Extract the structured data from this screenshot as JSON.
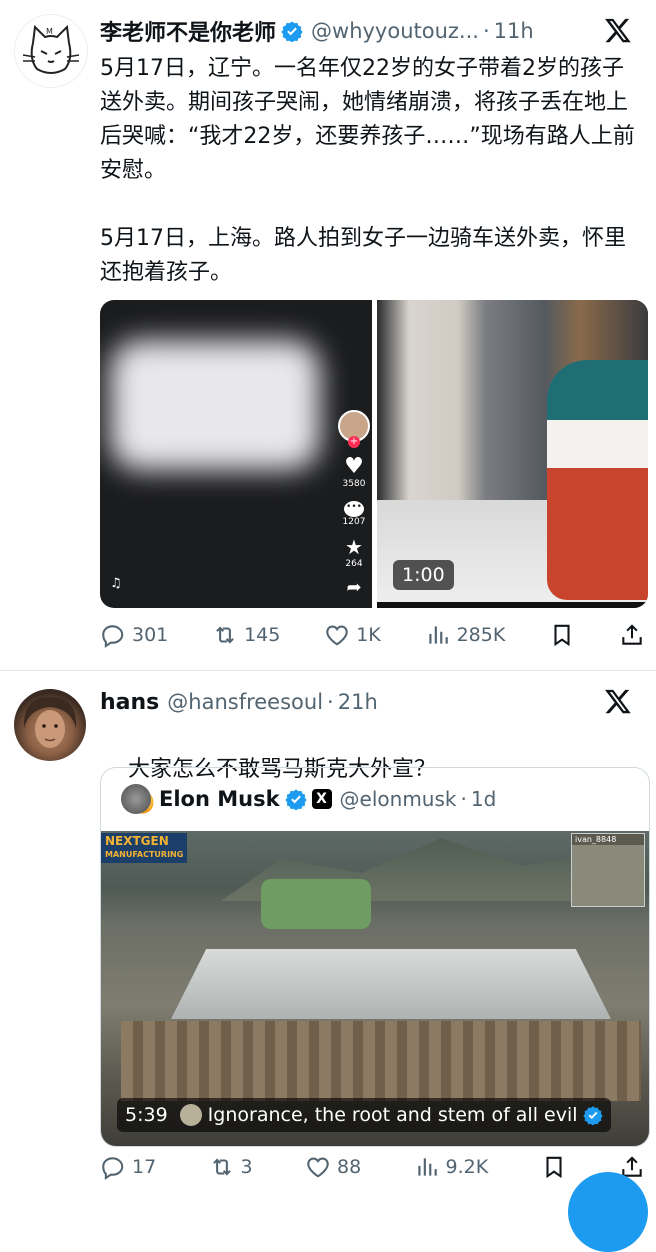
{
  "tweet1": {
    "display_name": "李老师不是你老师",
    "handle": "@whyyoutouz...",
    "time": "11h",
    "text": "5月17日，辽宁。一名年仅22岁的女子带着2岁的孩子送外卖。期间孩子哭闹，她情绪崩溃，将孩子丢在地上后哭喊：“我才22岁，还要养孩子……”现场有路人上前安慰。\n\n5月17日，上海。路人拍到女子一边骑车送外卖，怀里还抱着孩子。",
    "left_video": {
      "likes": "3580",
      "comments": "1207",
      "favorites": "264"
    },
    "right_video": {
      "duration": "1:00"
    },
    "stats": {
      "replies": "301",
      "reposts": "145",
      "likes": "1K",
      "views": "285K"
    }
  },
  "tweet2": {
    "display_name": "hans",
    "handle": "@hansfreesoul",
    "time": "21h",
    "text": "大家怎么不敢骂马斯克大外宣？",
    "emoji": "🤭",
    "quote": {
      "display_name": "Elon Musk",
      "handle": "@elonmusk",
      "time": "1d",
      "video_overlay_left": "NEXTGEN",
      "video_overlay_left_sub": "MANUFACTURING",
      "video_overlay_right": "ivan_8848",
      "duration": "5:39",
      "caption": "Ignorance, the root and stem of all evil"
    },
    "stats": {
      "replies": "17",
      "reposts": "3",
      "likes": "88",
      "views": "9.2K"
    }
  },
  "colors": {
    "accent": "#1d9bf0",
    "secondary_text": "#536471",
    "divider": "#e5e5e5"
  }
}
